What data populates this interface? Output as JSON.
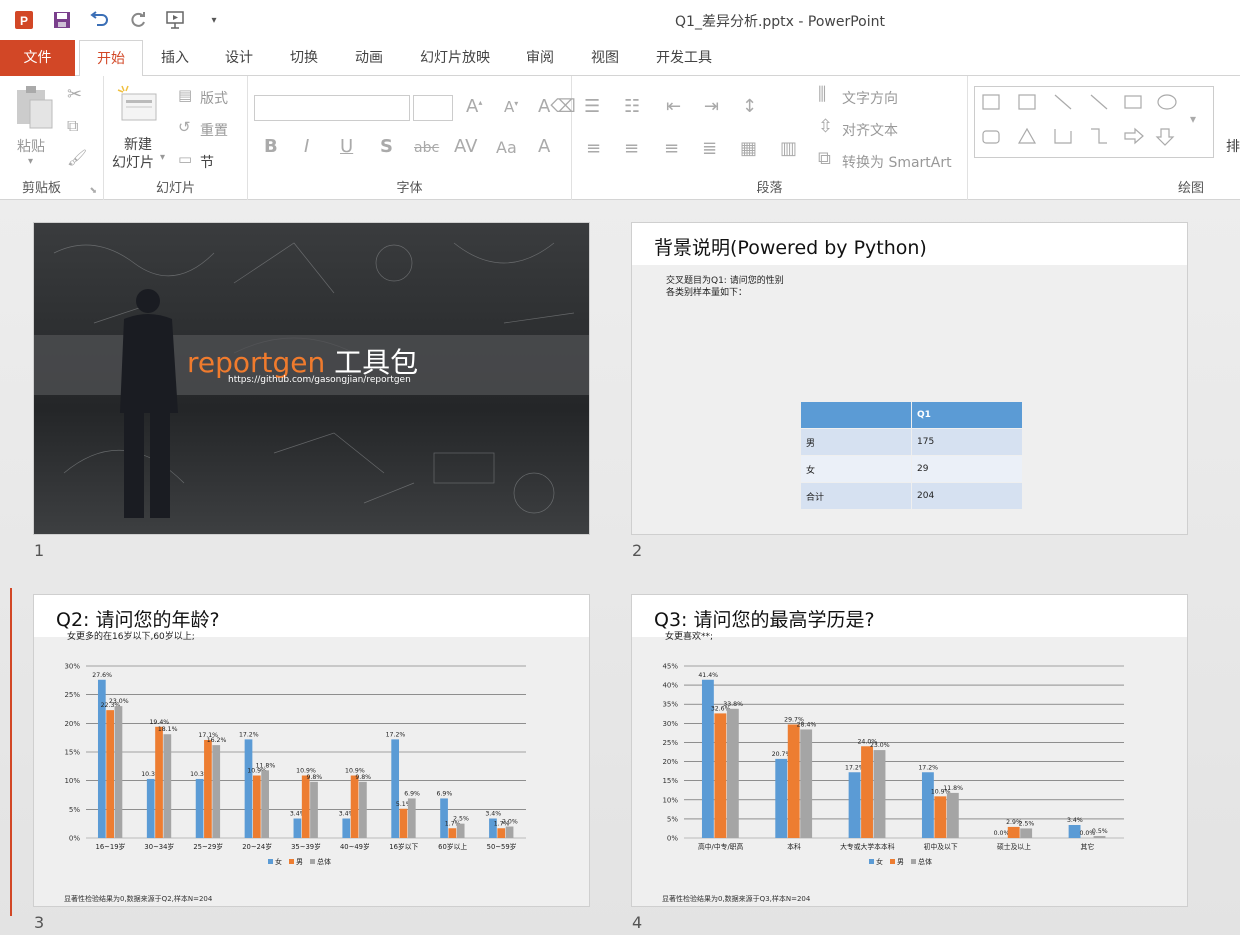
{
  "window": {
    "title": "Q1_差异分析.pptx - PowerPoint"
  },
  "tabs": [
    "文件",
    "开始",
    "插入",
    "设计",
    "切换",
    "动画",
    "幻灯片放映",
    "审阅",
    "视图",
    "开发工具"
  ],
  "ribbon": {
    "clipboard": {
      "paste": "粘贴",
      "label": "剪贴板"
    },
    "slides": {
      "new1": "新建",
      "new2": "幻灯片",
      "layout": "版式",
      "reset": "重置",
      "section": "节",
      "label": "幻灯片"
    },
    "font": {
      "label": "字体"
    },
    "paragraph": {
      "text_direction": "文字方向",
      "align_text": "对齐文本",
      "smartart": "转换为 SmartArt",
      "label": "段落"
    },
    "drawing": {
      "arrange": "排",
      "label": "绘图"
    }
  },
  "slides": [
    {
      "num": "1",
      "title": "reportgen",
      "title_cn": "工具包",
      "url": "https://github.com/gasongjian/reportgen"
    },
    {
      "num": "2",
      "title": "背景说明(Powered by Python)",
      "line1": "交叉题目为Q1: 请问您的性别",
      "line2": "各类别样本量如下：",
      "table": {
        "header": [
          "",
          "Q1"
        ],
        "rows": [
          [
            "男",
            "175"
          ],
          [
            "女",
            "29"
          ],
          [
            "合计",
            "204"
          ]
        ]
      }
    },
    {
      "num": "3",
      "title": "Q2: 请问您的年龄?",
      "note": "女更多的在16岁以下,60岁以上;",
      "footnote": "显著性检验结果为0,数据来源于Q2,样本N=204"
    },
    {
      "num": "4",
      "title": "Q3: 请问您的最高学历是?",
      "note": "女更喜欢**;",
      "footnote": "显著性检验结果为0,数据来源于Q3,样本N=204"
    }
  ],
  "chart_data": [
    {
      "type": "bar",
      "categories": [
        "16~19岁",
        "30~34岁",
        "25~29岁",
        "20~24岁",
        "35~39岁",
        "40~49岁",
        "16岁以下",
        "60岁以上",
        "50~59岁"
      ],
      "series": [
        {
          "name": "女",
          "color": "#5b9bd5",
          "values": [
            27.6,
            10.3,
            10.3,
            17.2,
            3.4,
            3.4,
            17.2,
            6.9,
            3.4
          ],
          "labels": [
            "27.6%",
            "10.3%",
            "10.3%",
            "17.2%",
            "3.4%",
            "3.4%",
            "17.2%",
            "6.9%",
            "3.4%"
          ]
        },
        {
          "name": "男",
          "color": "#ed7d31",
          "values": [
            22.3,
            19.4,
            17.1,
            10.9,
            10.9,
            10.9,
            5.1,
            1.7,
            1.7
          ],
          "labels": [
            "22.3%",
            "19.4%",
            "17.1%",
            "10.9%",
            "10.9%",
            "10.9%",
            "5.1%",
            "1.7%",
            "1.7%"
          ]
        },
        {
          "name": "总体",
          "color": "#a5a5a5",
          "values": [
            23.0,
            18.1,
            16.2,
            11.8,
            9.8,
            9.8,
            6.9,
            2.5,
            2.0
          ],
          "labels": [
            "23.0%",
            "18.1%",
            "16.2%",
            "11.8%",
            "9.8%",
            "9.8%",
            "6.9%",
            "2.5%",
            "2.0%"
          ]
        }
      ],
      "yticks": [
        "0%",
        "5%",
        "10%",
        "15%",
        "20%",
        "25%",
        "30%"
      ],
      "ylim": [
        0,
        30
      ],
      "legend": "bottom"
    },
    {
      "type": "bar",
      "categories": [
        "高中/中专/职高",
        "本科",
        "大专或大学本本科",
        "初中及以下",
        "硕士及以上",
        "其它"
      ],
      "series": [
        {
          "name": "女",
          "color": "#5b9bd5",
          "values": [
            41.4,
            20.7,
            17.2,
            17.2,
            0.0,
            3.4
          ],
          "labels": [
            "41.4%",
            "20.7%",
            "17.2%",
            "17.2%",
            "0.0%",
            "3.4%"
          ]
        },
        {
          "name": "男",
          "color": "#ed7d31",
          "values": [
            32.6,
            29.7,
            24.0,
            10.9,
            2.9,
            0.0
          ],
          "labels": [
            "32.6%",
            "29.7%",
            "24.0%",
            "10.9%",
            "2.9%",
            "0.0%"
          ]
        },
        {
          "name": "总体",
          "color": "#a5a5a5",
          "values": [
            33.8,
            28.4,
            23.0,
            11.8,
            2.5,
            0.5
          ],
          "labels": [
            "33.8%",
            "28.4%",
            "23.0%",
            "11.8%",
            "2.5%",
            "0.5%"
          ]
        }
      ],
      "yticks": [
        "0%",
        "5%",
        "10%",
        "15%",
        "20%",
        "25%",
        "30%",
        "35%",
        "40%",
        "45%"
      ],
      "ylim": [
        0,
        45
      ],
      "legend": "bottom"
    }
  ]
}
